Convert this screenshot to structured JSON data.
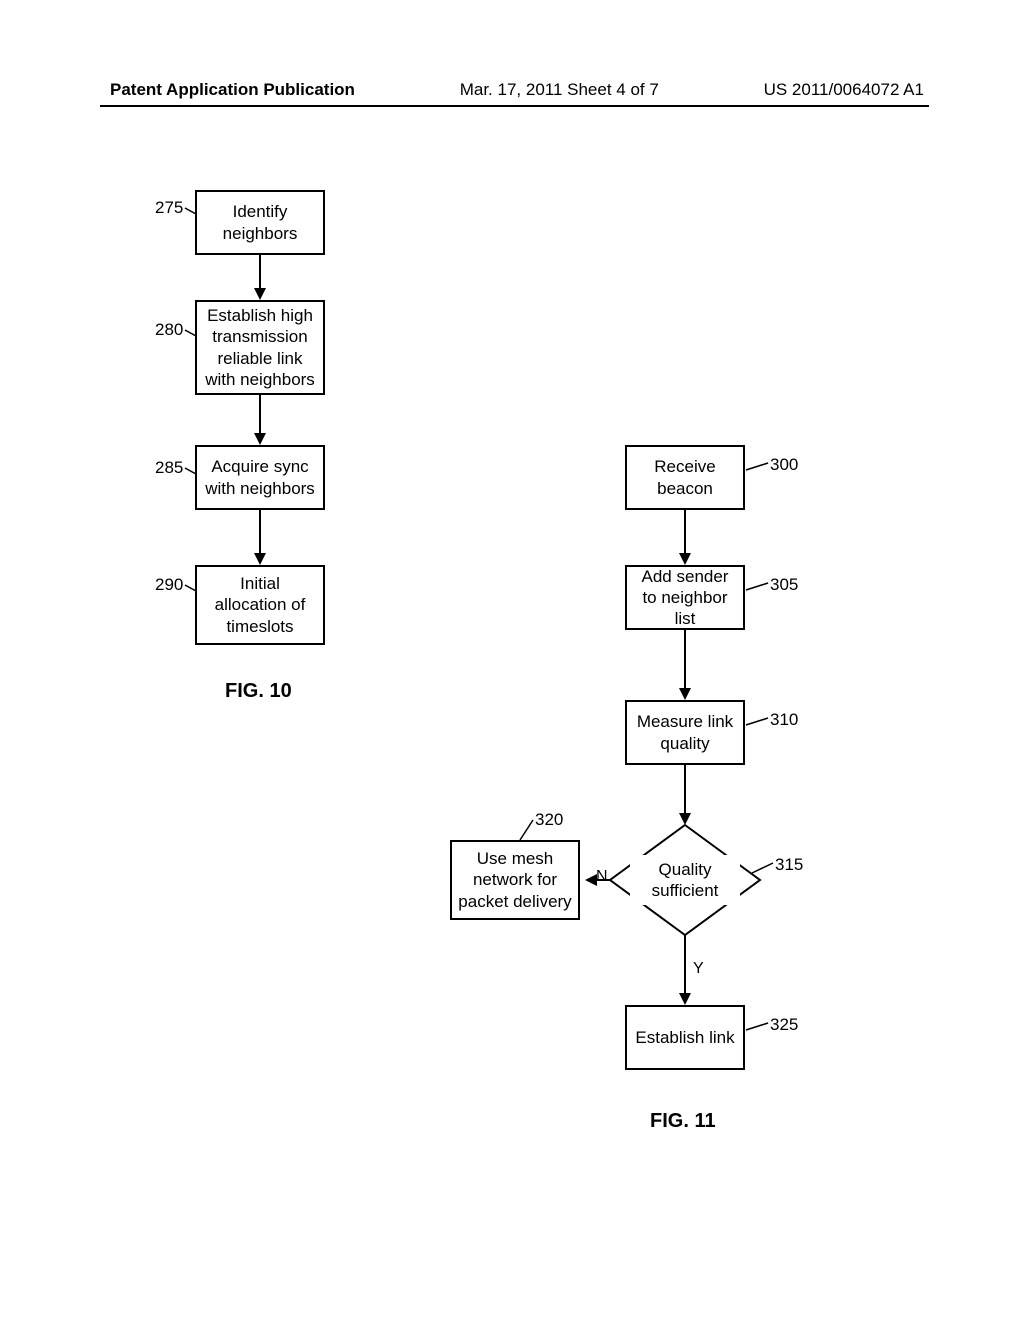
{
  "header": {
    "left": "Patent Application Publication",
    "mid": "Mar. 17, 2011  Sheet 4 of 7",
    "right": "US 2011/0064072 A1"
  },
  "fig10": {
    "caption": "FIG. 10",
    "boxes": {
      "b275": {
        "ref": "275",
        "text": "Identify neighbors"
      },
      "b280": {
        "ref": "280",
        "text": "Establish high transmission reliable link with neighbors"
      },
      "b285": {
        "ref": "285",
        "text": "Acquire sync with neighbors"
      },
      "b290": {
        "ref": "290",
        "text": "Initial allocation of timeslots"
      }
    }
  },
  "fig11": {
    "caption": "FIG. 11",
    "boxes": {
      "b300": {
        "ref": "300",
        "text": "Receive beacon"
      },
      "b305": {
        "ref": "305",
        "text": "Add sender to neighbor list"
      },
      "b310": {
        "ref": "310",
        "text": "Measure link quality"
      },
      "b315": {
        "ref": "315",
        "text": "Quality sufficient"
      },
      "b320": {
        "ref": "320",
        "text": "Use mesh network for packet delivery"
      },
      "b325": {
        "ref": "325",
        "text": "Establish link"
      }
    },
    "edges": {
      "no": "N",
      "yes": "Y"
    }
  }
}
